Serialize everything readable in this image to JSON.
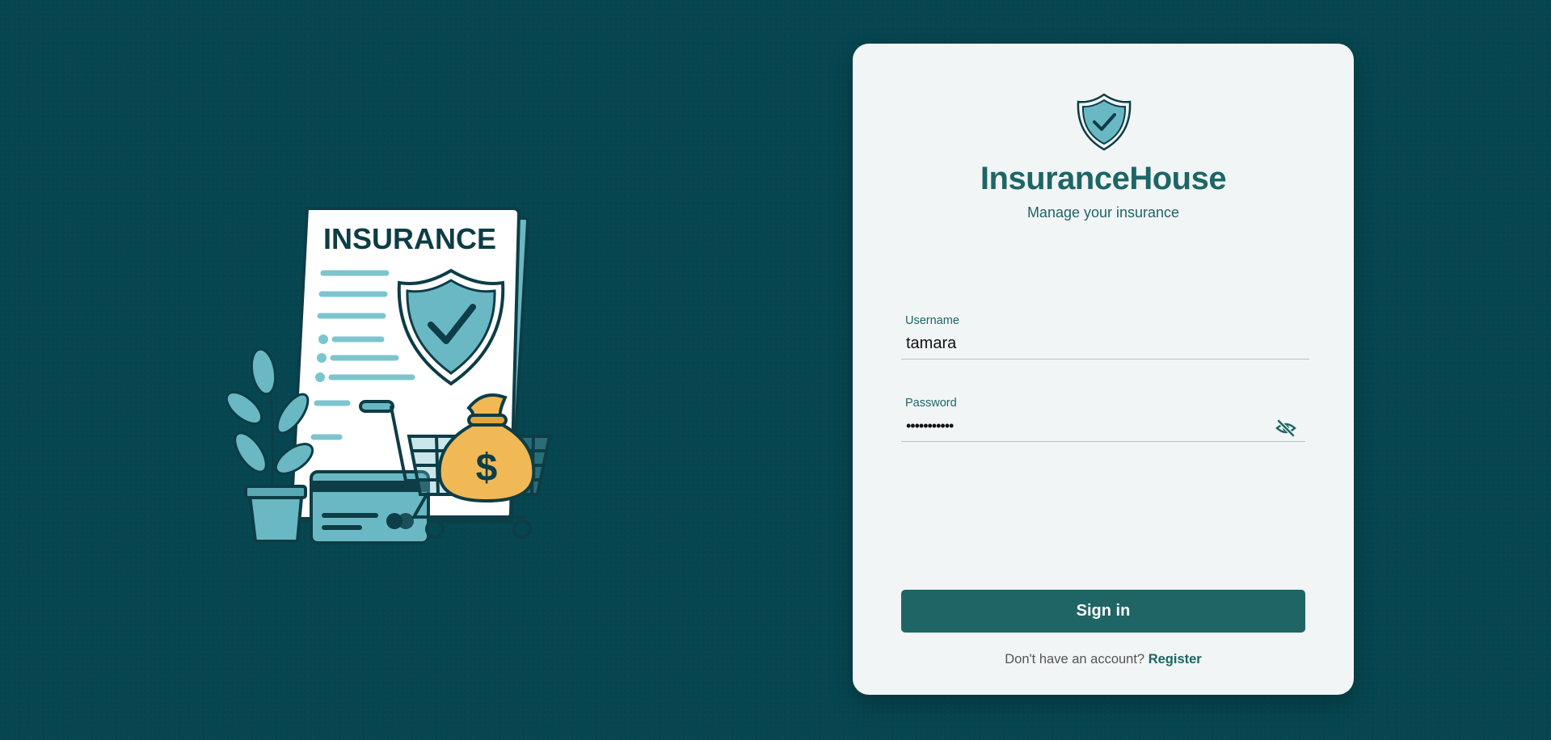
{
  "illustration": {
    "doc_title": "INSURANCE",
    "money_symbol": "$"
  },
  "brand": {
    "title": "InsuranceHouse",
    "subtitle": "Manage your insurance"
  },
  "form": {
    "username": {
      "label": "Username",
      "value": "tamara"
    },
    "password": {
      "label": "Password",
      "value": "•••••••••••"
    },
    "submit_label": "Sign in"
  },
  "footer": {
    "prompt": "Don't have an account?",
    "register_label": "Register"
  },
  "colors": {
    "background": "#064650",
    "card": "#f1f5f5",
    "accent": "#1f6566",
    "illustration_teal": "#6ab8c4",
    "money_bag": "#f0b955"
  },
  "icons": {
    "brand": "shield-check-icon",
    "password_toggle": "eye-off-icon"
  }
}
